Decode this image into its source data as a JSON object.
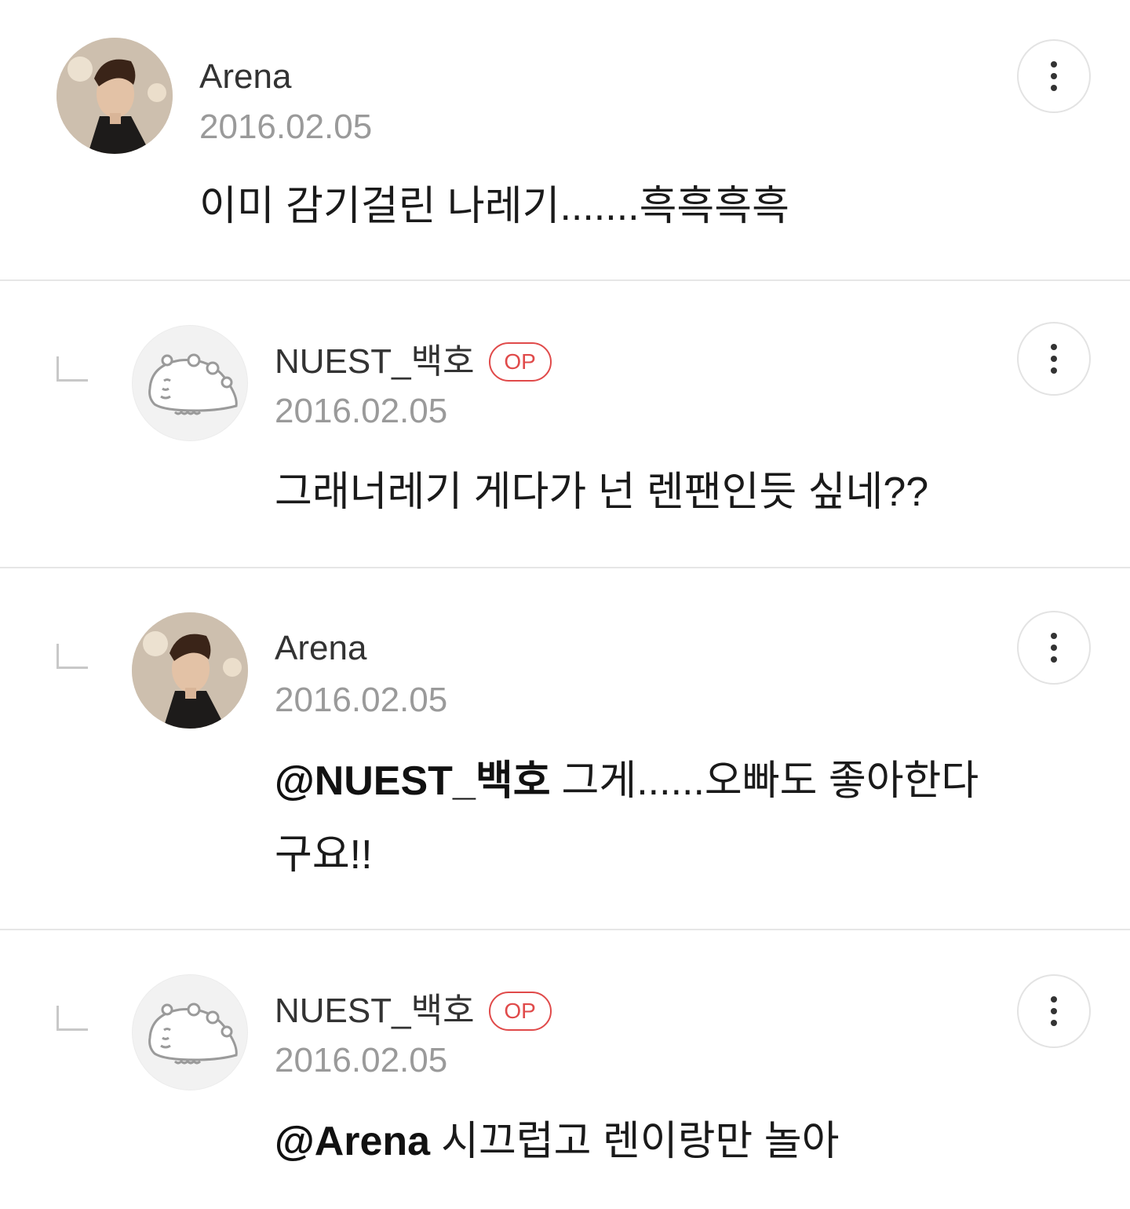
{
  "comments": [
    {
      "author": "Arena",
      "date": "2016.02.05",
      "is_op": false,
      "is_reply": false,
      "avatar": "profile-photo",
      "mention": "",
      "text": "이미 감기걸린 나레기.......흑흑흑흑"
    },
    {
      "author": "NUEST_백호",
      "date": "2016.02.05",
      "is_op": true,
      "op_label": "OP",
      "is_reply": true,
      "avatar": "dinosaur-mascot",
      "mention": "",
      "text": "그래너레기 게다가 넌 렌팬인듯 싶네??"
    },
    {
      "author": "Arena",
      "date": "2016.02.05",
      "is_op": false,
      "is_reply": true,
      "avatar": "profile-photo",
      "mention": "@NUEST_백호",
      "text": "그게......오빠도 좋아한다구요!!"
    },
    {
      "author": "NUEST_백호",
      "date": "2016.02.05",
      "is_op": true,
      "op_label": "OP",
      "is_reply": true,
      "avatar": "dinosaur-mascot",
      "mention": "@Arena",
      "text": "시끄럽고 렌이랑만 놀아"
    }
  ],
  "icons": {
    "more": "more-vertical-icon",
    "reply": "reply-corner-icon"
  },
  "colors": {
    "op_badge": "#e04a4a",
    "date": "#9a9a9a",
    "divider": "#e6e6e6"
  }
}
